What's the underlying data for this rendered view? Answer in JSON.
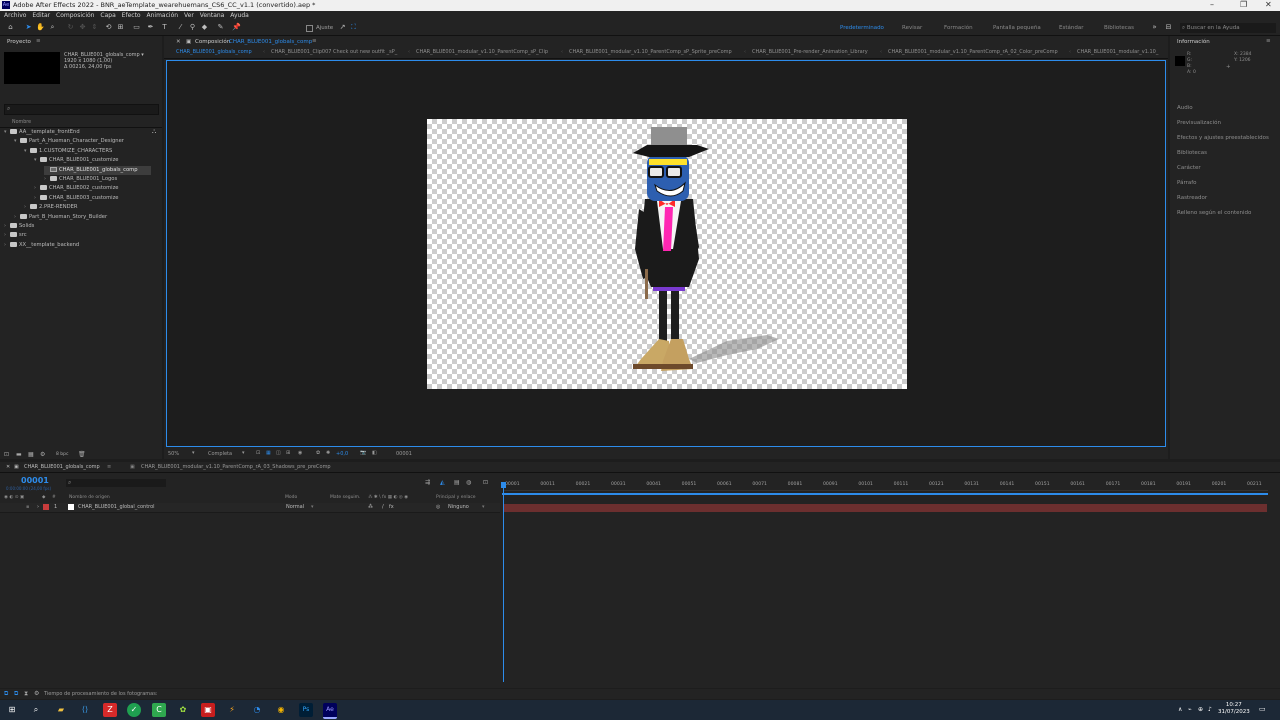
{
  "window": {
    "title": "Adobe After Effects 2022 - BNR_aeTemplate_wearehuemans_CS6_CC_v1.1 (convertido).aep *",
    "app_icon": "Ae",
    "controls": [
      "–",
      "❐",
      "✕"
    ]
  },
  "menu": [
    "Archivo",
    "Editar",
    "Composición",
    "Capa",
    "Efecto",
    "Animación",
    "Ver",
    "Ventana",
    "Ayuda"
  ],
  "toolbar": {
    "align_label": "Ajuste",
    "workspaces": [
      {
        "label": "Predeterminado",
        "active": true
      },
      {
        "label": "Revisar",
        "active": false
      },
      {
        "label": "Formación",
        "active": false
      },
      {
        "label": "Pantalla pequeña",
        "active": false
      },
      {
        "label": "Estándar",
        "active": false
      },
      {
        "label": "Bibliotecas",
        "active": false
      }
    ],
    "search_help": "Buscar en la Ayuda"
  },
  "project": {
    "title": "Proyecto",
    "comp_name": "CHAR_BLUE001_globals_comp ▾",
    "comp_dims": "1920 x 1080 (1,00)",
    "comp_dur": "Δ 00216, 24,00 fps",
    "column": "Nombre",
    "tree": [
      {
        "label": "AA__template_frontEnd",
        "depth": 0,
        "type": "folder",
        "open": true,
        "selected": false
      },
      {
        "label": "Part_A_Hueman_Character_Designer",
        "depth": 1,
        "type": "folder",
        "open": true,
        "selected": false
      },
      {
        "label": "1.CUSTOMIZE_CHARACTERS",
        "depth": 2,
        "type": "folder",
        "open": true,
        "selected": false
      },
      {
        "label": "CHAR_BLUE001_customize",
        "depth": 3,
        "type": "folder",
        "open": true,
        "selected": false
      },
      {
        "label": "CHAR_BLUE001_globals_comp",
        "depth": 4,
        "type": "comp",
        "open": false,
        "selected": true
      },
      {
        "label": "CHAR_BLUE001_Logos",
        "depth": 4,
        "type": "folder",
        "open": false,
        "selected": false
      },
      {
        "label": "CHAR_BLUE002_customize",
        "depth": 3,
        "type": "folder",
        "open": false,
        "selected": false
      },
      {
        "label": "CHAR_BLUE003_customize",
        "depth": 3,
        "type": "folder",
        "open": false,
        "selected": false
      },
      {
        "label": "2.PRE-RENDER",
        "depth": 2,
        "type": "folder",
        "open": false,
        "selected": false
      },
      {
        "label": "Part_B_Hueman_Story_Builder",
        "depth": 1,
        "type": "folder",
        "open": false,
        "selected": false
      },
      {
        "label": "Solids",
        "depth": 0,
        "type": "folder",
        "open": false,
        "selected": false
      },
      {
        "label": "src",
        "depth": 0,
        "type": "folder",
        "open": false,
        "selected": false
      },
      {
        "label": "XX__template_backend",
        "depth": 0,
        "type": "folder",
        "open": false,
        "selected": false
      }
    ],
    "bpc": "8 bpc"
  },
  "composition": {
    "panel_label": "Composición",
    "panel_comp": "CHAR_BLUE001_globals_comp",
    "tabs": [
      {
        "label": "CHAR_BLUE001_globals_comp",
        "active": true
      },
      {
        "label": "CHAR_BLUE001_Clip007 Check out new outfit _sP_",
        "active": false
      },
      {
        "label": "CHAR_BLUE001_modular_v1.10_ParentComp_sP_Clip",
        "active": false
      },
      {
        "label": "CHAR_BLUE001_modular_v1.10_ParentComp_sP_Sprite_preComp",
        "active": false
      },
      {
        "label": "CHAR_BLUE001_Pre-render_Animation_Library",
        "active": false
      },
      {
        "label": "CHAR_BLUE001_modular_v1.10_ParentComp_rA_02_Color_preComp",
        "active": false
      },
      {
        "label": "CHAR_BLUE001_modular_v1.10_",
        "active": false
      }
    ],
    "zoom": "50%",
    "resolution": "Completa",
    "exposure": "+0,0",
    "frame": "00001"
  },
  "info": {
    "title": "Información",
    "coords": {
      "x": "X: 2384",
      "y": "Y: 1206"
    },
    "rgb": [
      "R:",
      "G:",
      "B:",
      "A: 0"
    ],
    "panels": [
      "Audio",
      "Previsualización",
      "Efectos y ajustes preestablecidos",
      "Bibliotecas",
      "Carácter",
      "Párrafo",
      "Rastreador",
      "Relleno según el contenido"
    ]
  },
  "timeline": {
    "tabs": [
      "CHAR_BLUE001_globals_comp",
      "CHAR_BLUE001_modular_v1.10_ParentComp_rA_03_Shadows_pre_preComp"
    ],
    "timecode": "00001",
    "timecode_sub": "0:00:00:00 (24,00 fps)",
    "columns": {
      "source": "Nombre de origen",
      "mode": "Modo",
      "matte": "Mate seguim.",
      "parent": "Principal y enlace"
    },
    "ticks": [
      "00001",
      "00011",
      "00021",
      "00031",
      "00041",
      "00051",
      "00061",
      "00071",
      "00081",
      "00091",
      "00101",
      "00111",
      "00121",
      "00131",
      "00141",
      "00151",
      "00161",
      "00171",
      "00181",
      "00191",
      "00201",
      "00211"
    ],
    "layers": [
      {
        "num": "1",
        "name": "CHAR_BLUE001_global_control",
        "mode": "Normal",
        "parent": "Ninguno",
        "color": "#c83c3c"
      }
    ],
    "status_text": "Tiempo de procesamiento de los fotogramas:"
  },
  "taskbar": {
    "time": "10:27",
    "date": "31/07/2023"
  },
  "colors": {
    "accent": "#2d8ceb",
    "layer_bar": "#6c2f2f"
  }
}
